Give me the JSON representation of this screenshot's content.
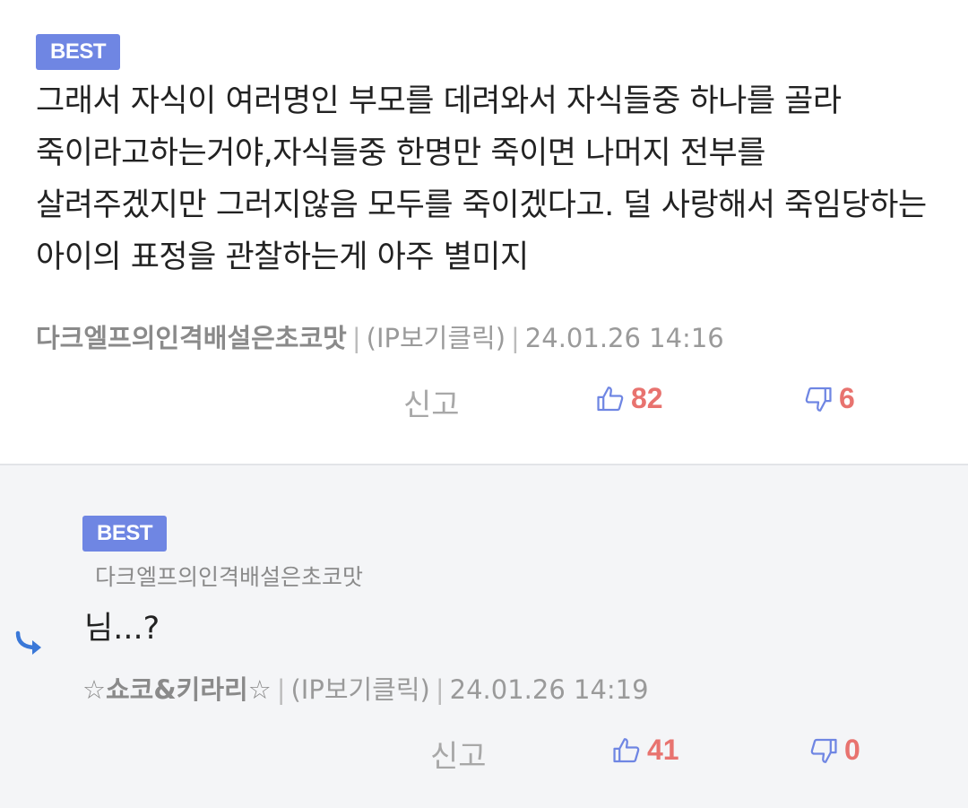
{
  "colors": {
    "badge": "#6f86e3",
    "count": "#e8736f",
    "thumb_icon": "#6f86e3",
    "reply_bg": "#f4f5f7"
  },
  "main_comment": {
    "badge": "BEST",
    "text": "그래서 자식이 여러명인 부모를 데려와서 자식들중 하나를 골라 죽이라고하는거야,자식들중 한명만 죽이면 나머지 전부를 살려주겠지만 그러지않음 모두를 죽이겠다고. 덜 사랑해서 죽임당하는 아이의 표정을 관찰하는게 아주 별미지",
    "author": "다크엘프의인격배설은초코맛",
    "ip": "(IP보기클릭)",
    "separator": "|",
    "timestamp": "24.01.26 14:16",
    "report_label": "신고",
    "likes": "82",
    "dislikes": "6",
    "like_icon": "thumbs-up-icon",
    "dislike_icon": "thumbs-down-icon"
  },
  "reply_comment": {
    "badge": "BEST",
    "reply_to": "다크엘프의인격배설은초코맛",
    "text": "님...?",
    "author": "☆쇼코&키라리☆",
    "ip": "(IP보기클릭)",
    "separator": "|",
    "timestamp": "24.01.26 14:19",
    "report_label": "신고",
    "likes": "41",
    "dislikes": "0",
    "reply_icon": "reply-arrow-icon"
  }
}
